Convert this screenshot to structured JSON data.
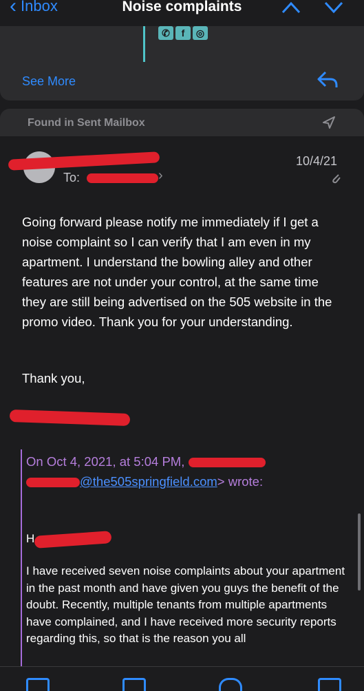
{
  "nav": {
    "back_label": "Inbox",
    "title": "Noise complaints"
  },
  "prev_card": {
    "see_more": "See More"
  },
  "message": {
    "found_in": "Found in Sent Mailbox",
    "to_label": "To:",
    "date": "10/4/21",
    "body": "Going forward please notify me immediately if I get a noise complaint so I can verify that I am even in my apartment. I understand the bowling alley and other features are not under your control, at the same time they are still being advertised on the 505 website in the promo video. Thank you for your understanding.",
    "closing": "Thank you,",
    "quote": {
      "header_prefix": "On Oct 4, 2021, at 5:04 PM,",
      "email_link": "@the505springfield.com",
      "wrote": "> wrote:",
      "greeting": "H",
      "body": "I have received seven noise complaints about your apartment in the past month and have given you guys the benefit of the doubt. Recently, multiple tenants from multiple apartments have complained, and I have received more security reports regarding this, so that is the reason you all"
    }
  },
  "colors": {
    "accent": "#2f8bff",
    "quote": "#b57edc",
    "redaction": "#e0202c"
  }
}
